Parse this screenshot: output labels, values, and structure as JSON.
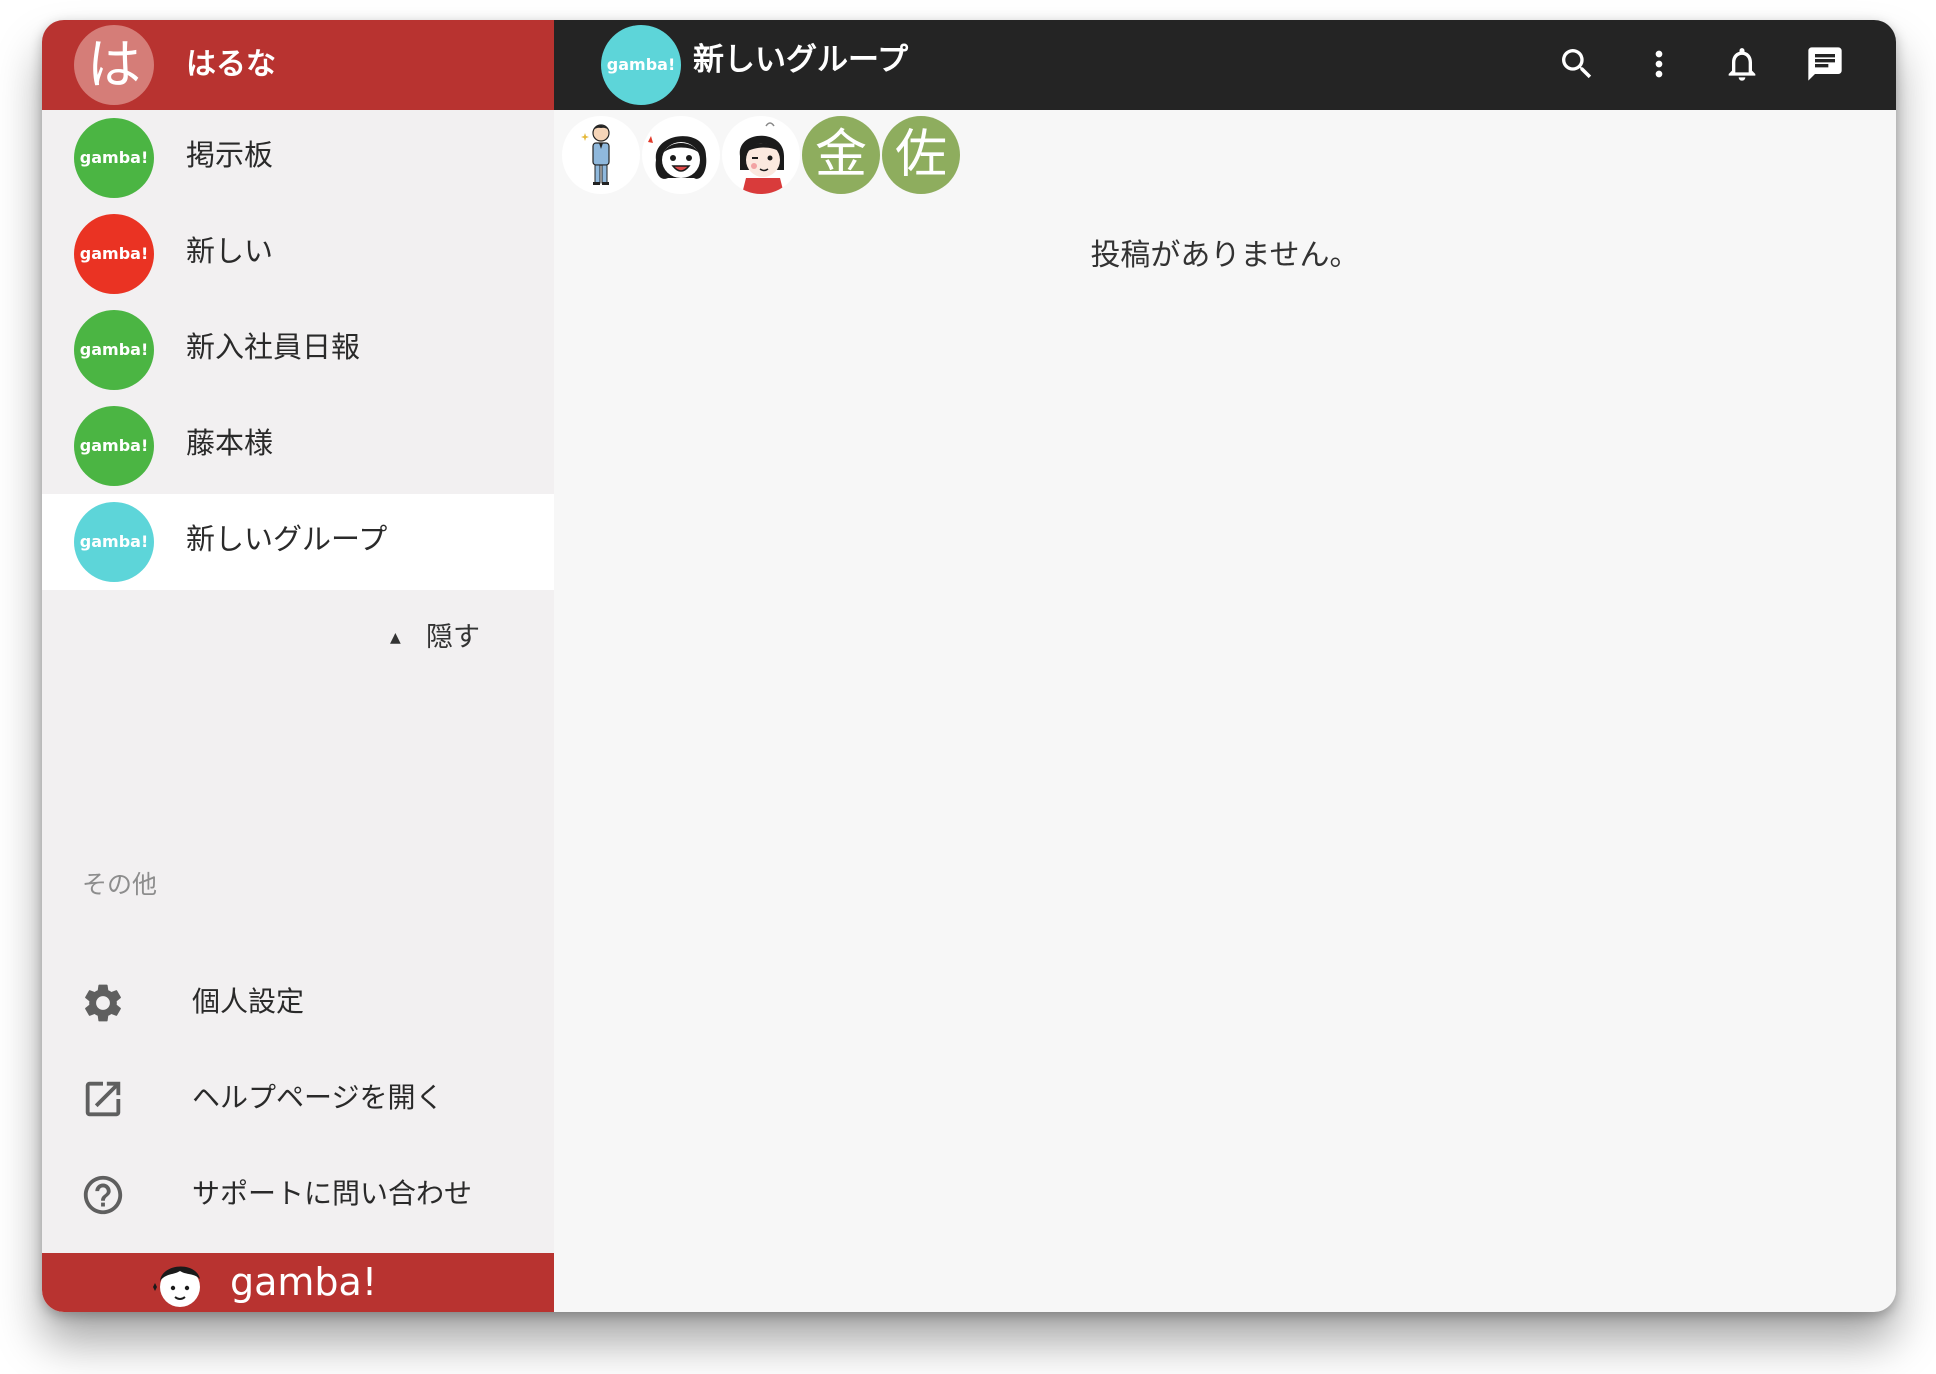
{
  "user": {
    "avatar_char": "は",
    "name": "はるな"
  },
  "groups": [
    {
      "label": "掲示板",
      "avatar_text": "gamba!",
      "color": "#4bb543"
    },
    {
      "label": "新しい",
      "avatar_text": "gamba!",
      "color": "#ea3323"
    },
    {
      "label": "新入社員日報",
      "avatar_text": "gamba!",
      "color": "#4bb543"
    },
    {
      "label": "藤本様",
      "avatar_text": "gamba!",
      "color": "#4bb543"
    },
    {
      "label": "新しいグループ",
      "avatar_text": "gamba!",
      "color": "#5dd5d9"
    }
  ],
  "hide_label": "隠す",
  "other_section": {
    "title": "その他",
    "items": [
      {
        "label": "個人設定",
        "icon": "gear-icon"
      },
      {
        "label": "ヘルプページを開く",
        "icon": "external-link-icon"
      },
      {
        "label": "サポートに問い合わせ",
        "icon": "help-circle-icon"
      }
    ]
  },
  "footer": {
    "brand": "gamba!"
  },
  "topbar": {
    "avatar_text": "gamba!",
    "title": "新しいグループ",
    "icons": [
      "search-icon",
      "more-vert-icon",
      "bell-icon",
      "chat-icon"
    ]
  },
  "members": [
    {
      "type": "illustration",
      "icon": "businessman-avatar"
    },
    {
      "type": "illustration",
      "icon": "girl-smiling-avatar"
    },
    {
      "type": "illustration",
      "icon": "girl-winking-avatar"
    },
    {
      "type": "letter",
      "char": "金"
    },
    {
      "type": "letter",
      "char": "佐"
    }
  ],
  "empty_message": "投稿がありません。",
  "colors": {
    "brand_red": "#b83330",
    "topbar_dark": "#242424",
    "sidebar_bg": "#f2f0f1",
    "member_green": "#8ead5e"
  }
}
